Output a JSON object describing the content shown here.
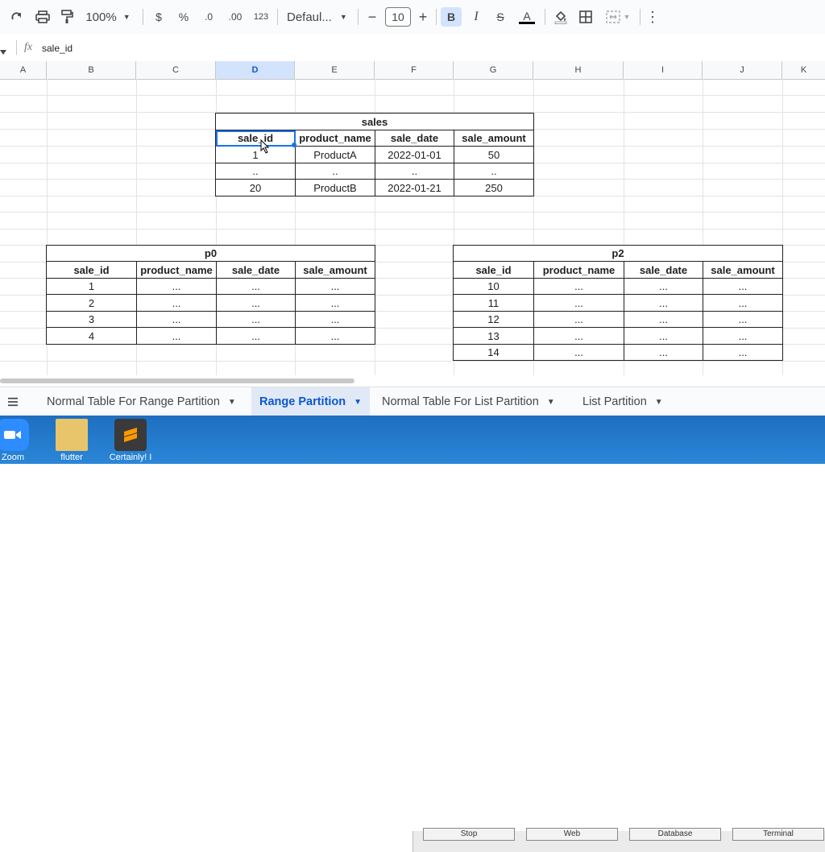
{
  "toolbar": {
    "zoom": "100%",
    "currency": "$",
    "percent": "%",
    "dec_decrease": ".0",
    "dec_increase": ".00",
    "number_format": "123",
    "font": "Defaul...",
    "font_size": "10",
    "minus": "−",
    "plus": "+",
    "bold": "B",
    "italic": "I",
    "strike": "S",
    "text_color": "A",
    "more": "⋮"
  },
  "formula": {
    "fx": "fx",
    "value": "sale_id"
  },
  "columns": [
    "A",
    "B",
    "C",
    "D",
    "E",
    "F",
    "G",
    "H",
    "I",
    "J",
    "K"
  ],
  "sales": {
    "title": "sales",
    "headers": [
      "sale_id",
      "product_name",
      "sale_date",
      "sale_amount"
    ],
    "rows": [
      [
        "1",
        "ProductA",
        "2022-01-01",
        "50"
      ],
      [
        "..",
        "..",
        "..",
        ".."
      ],
      [
        "20",
        "ProductB",
        "2022-01-21",
        "250"
      ]
    ]
  },
  "p0": {
    "title": "p0",
    "headers": [
      "sale_id",
      "product_name",
      "sale_date",
      "sale_amount"
    ],
    "rows": [
      [
        "1",
        "...",
        "...",
        "..."
      ],
      [
        "2",
        "...",
        "...",
        "..."
      ],
      [
        "3",
        "...",
        "...",
        "..."
      ],
      [
        "4",
        "...",
        "...",
        "..."
      ]
    ]
  },
  "p2": {
    "title": "p2",
    "headers": [
      "sale_id",
      "product_name",
      "sale_date",
      "sale_amount"
    ],
    "rows": [
      [
        "10",
        "...",
        "...",
        "..."
      ],
      [
        "11",
        "...",
        "...",
        "..."
      ],
      [
        "12",
        "...",
        "...",
        "..."
      ],
      [
        "13",
        "...",
        "...",
        "..."
      ],
      [
        "14",
        "...",
        "...",
        "..."
      ]
    ]
  },
  "tabs": [
    {
      "label": "Normal Table For Range Partition"
    },
    {
      "label": "Range Partition"
    },
    {
      "label": "Normal Table For List Partition"
    },
    {
      "label": "List Partition"
    }
  ],
  "desktop": {
    "icons": [
      {
        "label": "Zoom"
      },
      {
        "label": "flutter"
      },
      {
        "label": "Certainly! I"
      }
    ],
    "window_buttons": [
      "Stop",
      "Web",
      "Database",
      "Terminal"
    ]
  },
  "colors": {
    "accent": "#0b57d0",
    "selected_header": "#d3e3fd",
    "desktop": "#1e6fc0"
  }
}
